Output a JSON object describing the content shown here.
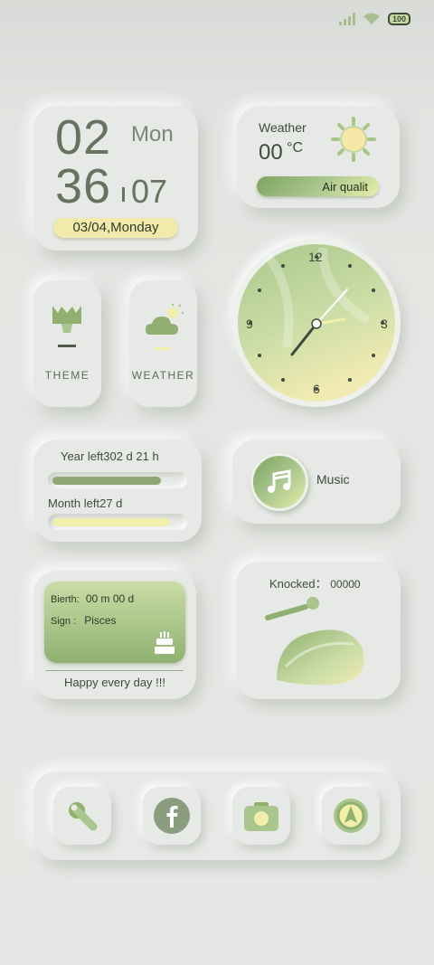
{
  "status": {
    "battery": "100"
  },
  "clock_widget": {
    "hour": "02",
    "minute": "36",
    "day": "Mon",
    "date_num": "07",
    "date_label": "03/04,Monday"
  },
  "weather": {
    "title": "Weather",
    "temp": "00",
    "unit": "°C",
    "air_label": "Air qualit"
  },
  "apps": {
    "theme_label": "THEME",
    "weather_label": "WEATHER"
  },
  "analog_clock": {
    "n12": "12",
    "n3": "3",
    "n6": "6",
    "n9": "9"
  },
  "countdown": {
    "year_label": "Year left",
    "year_value": "302 d  21 h",
    "year_progress": 0.83,
    "month_label": "Month left",
    "month_value": "27 d",
    "month_progress": 0.9
  },
  "music": {
    "label": "Music"
  },
  "birthday": {
    "birth_label": "Bierth:",
    "birth_value": "00 m 00  d",
    "sign_label": "Sign  :",
    "sign_value": "Pisces",
    "footer": "Happy every day !!!"
  },
  "knock": {
    "label": "Knocked：",
    "count": "00000"
  },
  "colors": {
    "accent_green": "#8fb06f",
    "accent_yellow": "#f2eeab",
    "text": "#4f5a4c"
  },
  "dock": {
    "icons": [
      "wrench-icon",
      "facebook-icon",
      "camera-icon",
      "navigation-icon"
    ]
  }
}
